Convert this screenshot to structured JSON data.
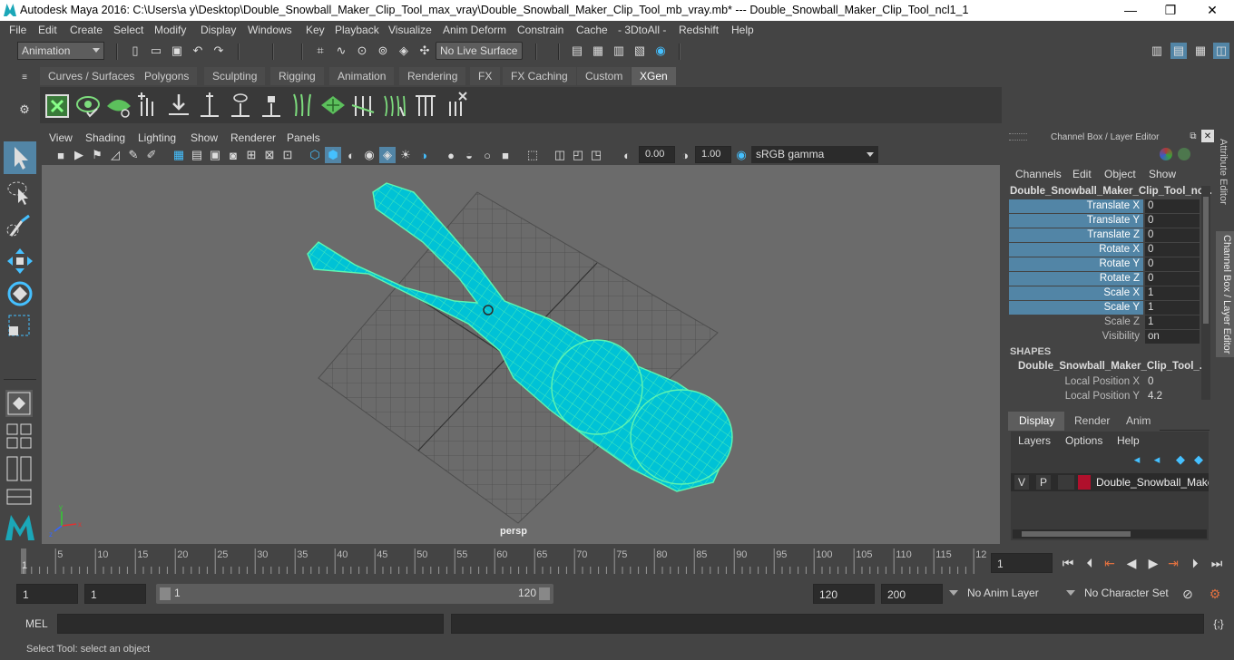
{
  "title_bar": {
    "text": "Autodesk Maya 2016: C:\\Users\\a y\\Desktop\\Double_Snowball_Maker_Clip_Tool_max_vray\\Double_Snowball_Maker_Clip_Tool_mb_vray.mb*   ---   Double_Snowball_Maker_Clip_Tool_ncl1_1",
    "minimize": "—",
    "maximize": "❐",
    "close": "✕"
  },
  "menu": [
    "File",
    "Edit",
    "Create",
    "Select",
    "Modify",
    "Display",
    "Windows",
    "Key",
    "Playback",
    "Visualize",
    "Anim Deform",
    "Constrain",
    "Cache",
    "- 3DtoAll -",
    "Redshift",
    "Help"
  ],
  "toolbar": {
    "mode": "Animation",
    "live_surface": "No Live Surface"
  },
  "shelf_tabs": [
    "Curves / Surfaces",
    "Polygons",
    "Sculpting",
    "Rigging",
    "Animation",
    "Rendering",
    "FX",
    "FX Caching",
    "Custom",
    "XGen"
  ],
  "active_shelf": "XGen",
  "viewport_menu": [
    "View",
    "Shading",
    "Lighting",
    "Show",
    "Renderer",
    "Panels"
  ],
  "viewport_toolbar": {
    "exposure": "0.00",
    "gamma": "1.00",
    "color_space": "sRGB gamma"
  },
  "viewport_label": "persp",
  "channel_box": {
    "header": "Channel Box / Layer Editor",
    "menus": [
      "Channels",
      "Edit",
      "Object",
      "Show"
    ],
    "object_name": "Double_Snowball_Maker_Clip_Tool_nc...",
    "channels": [
      {
        "label": "Translate X",
        "value": "0"
      },
      {
        "label": "Translate Y",
        "value": "0"
      },
      {
        "label": "Translate Z",
        "value": "0"
      },
      {
        "label": "Rotate X",
        "value": "0"
      },
      {
        "label": "Rotate Y",
        "value": "0"
      },
      {
        "label": "Rotate Z",
        "value": "0"
      },
      {
        "label": "Scale X",
        "value": "1"
      },
      {
        "label": "Scale Y",
        "value": "1"
      },
      {
        "label": "Scale Z",
        "value": "1"
      },
      {
        "label": "Visibility",
        "value": "on"
      }
    ],
    "shapes_header": "SHAPES",
    "shape_name": "Double_Snowball_Maker_Clip_Tool_...",
    "shape_channels": [
      {
        "label": "Local Position X",
        "value": "0"
      },
      {
        "label": "Local Position Y",
        "value": "4.2"
      }
    ]
  },
  "layer_editor": {
    "tabs": [
      "Display",
      "Render",
      "Anim"
    ],
    "menus": [
      "Layers",
      "Options",
      "Help"
    ],
    "layer": {
      "v": "V",
      "p": "P",
      "name": "Double_Snowball_Make",
      "color": "#b0102c"
    }
  },
  "side_tabs": [
    "Attribute Editor",
    "Channel Box / Layer Editor"
  ],
  "timeline": {
    "ticks": [
      "5",
      "10",
      "15",
      "20",
      "25",
      "30",
      "35",
      "40",
      "45",
      "50",
      "55",
      "60",
      "65",
      "70",
      "75",
      "80",
      "85",
      "90",
      "95",
      "100",
      "105",
      "110",
      "115",
      "12"
    ],
    "start_label": "1",
    "current_frame": "1"
  },
  "range": {
    "start": "1",
    "playback_start": "1",
    "slider_start": "1",
    "slider_end": "120",
    "playback_end": "120",
    "end": "200",
    "anim_layer": "No Anim Layer",
    "character_set": "No Character Set"
  },
  "command_line": {
    "label": "MEL"
  },
  "help_line": "Select Tool: select an object",
  "colors": {
    "mesh": "#00c2d6",
    "wire": "#5ff5b0",
    "selection": "#5285a6"
  }
}
